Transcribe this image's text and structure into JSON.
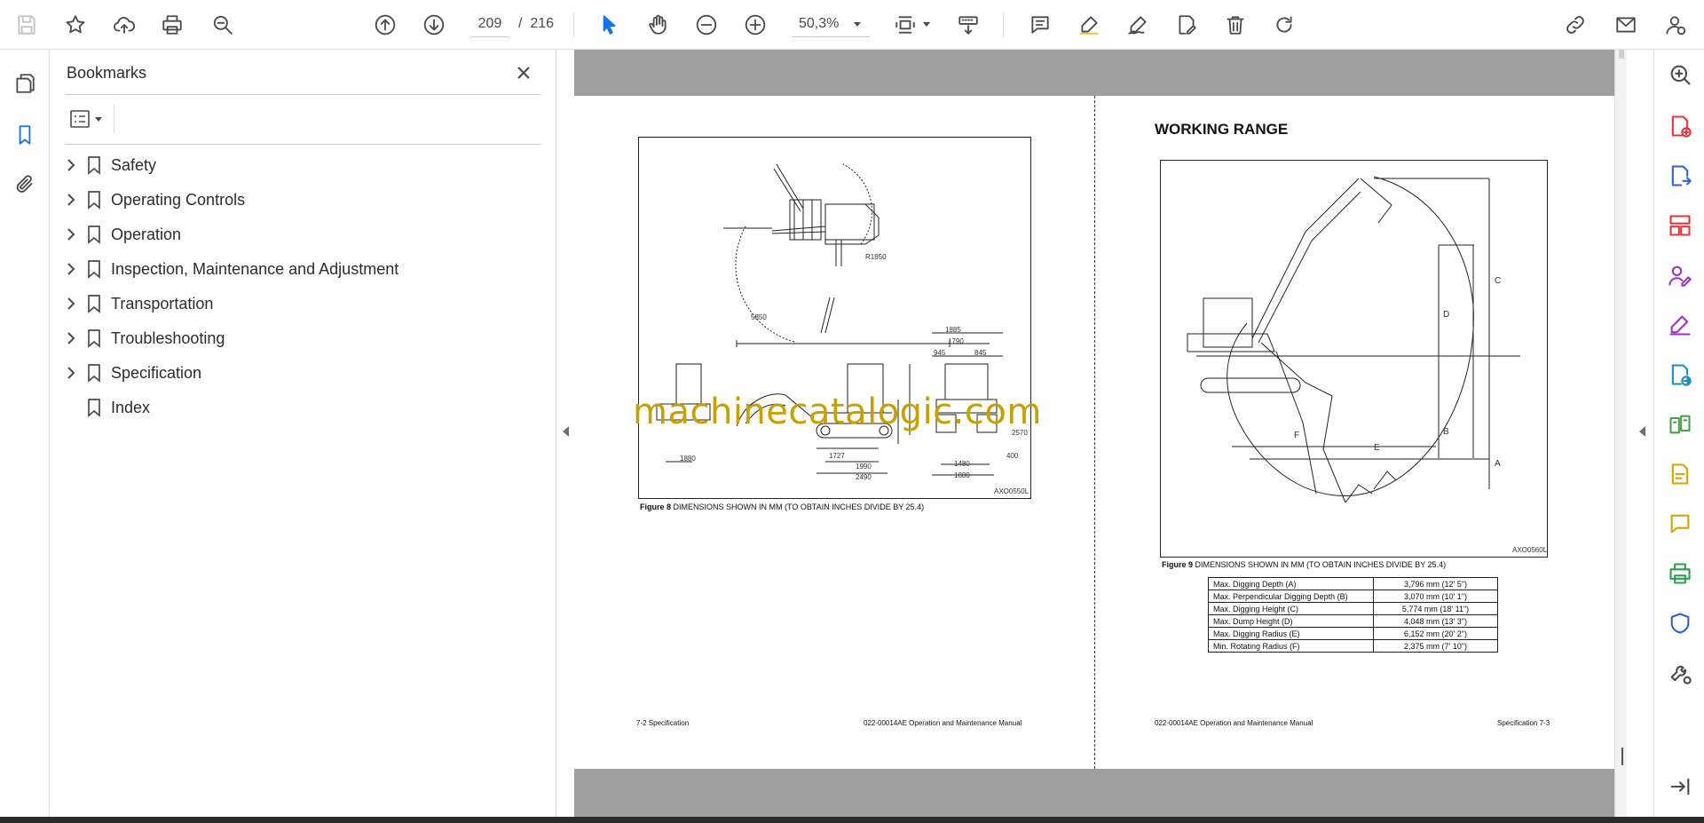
{
  "toolbar": {
    "current_page": "209",
    "page_separator": "/",
    "total_pages": "216",
    "zoom": "50,3%"
  },
  "bookmarks_panel": {
    "title": "Bookmarks",
    "items": [
      {
        "label": "Safety",
        "expandable": true
      },
      {
        "label": "Operating Controls",
        "expandable": true
      },
      {
        "label": "Operation",
        "expandable": true
      },
      {
        "label": "Inspection, Maintenance and Adjustment",
        "expandable": true
      },
      {
        "label": "Transportation",
        "expandable": true
      },
      {
        "label": "Troubleshooting",
        "expandable": true
      },
      {
        "label": "Specification",
        "expandable": true
      },
      {
        "label": "Index",
        "expandable": false
      }
    ]
  },
  "document": {
    "left_page": {
      "figure_code": "AXO0550L",
      "figure_label": "Figure 8",
      "figure_caption": "DIMENSIONS SHOWN IN MM (TO OBTAIN INCHES DIVIDE BY 25.4)",
      "footer_left": "7-2  Specification",
      "footer_right": "022-00014AE Operation and Maintenance Manual",
      "dims": {
        "d1": "5850",
        "d2": "1885",
        "d3": "1790",
        "d4": "945",
        "d5": "845",
        "d6": "1727",
        "d7": "1990",
        "d8": "2490",
        "d9": "1880",
        "d10": "1480",
        "d11": "1880",
        "d12": "400",
        "d13": "2570",
        "d14": "R1850"
      }
    },
    "right_page": {
      "heading": "WORKING RANGE",
      "figure_code": "AXO0560L",
      "figure_label": "Figure 9",
      "figure_caption": "DIMENSIONS SHOWN IN MM (TO OBTAIN INCHES DIVIDE BY 25.4)",
      "footer_left": "022-00014AE Operation and Maintenance Manual",
      "footer_right": "Specification 7-3",
      "range_letters": {
        "a": "A",
        "b": "B",
        "c": "C",
        "d": "D",
        "e": "E",
        "f": "F"
      },
      "table": [
        {
          "label": "Max. Digging Depth (A)",
          "value": "3,796 mm (12' 5\")"
        },
        {
          "label": "Max. Perpendicular Digging Depth (B)",
          "value": "3,070 mm (10' 1\")"
        },
        {
          "label": "Max. Digging Height (C)",
          "value": "5,774 mm (18' 11\")"
        },
        {
          "label": "Max. Dump Height (D)",
          "value": "4,048 mm (13' 3\")"
        },
        {
          "label": "Max. Digging Radius (E)",
          "value": "6,152 mm (20' 2\")"
        },
        {
          "label": "Min. Rotating Radius (F)",
          "value": "2,375 mm (7' 10\")"
        }
      ]
    },
    "watermark": "machinecatalogic.com"
  },
  "colors": {
    "accent": "#1473e6",
    "watermark": "#c8a000",
    "page_band": "#9f9f9f"
  }
}
